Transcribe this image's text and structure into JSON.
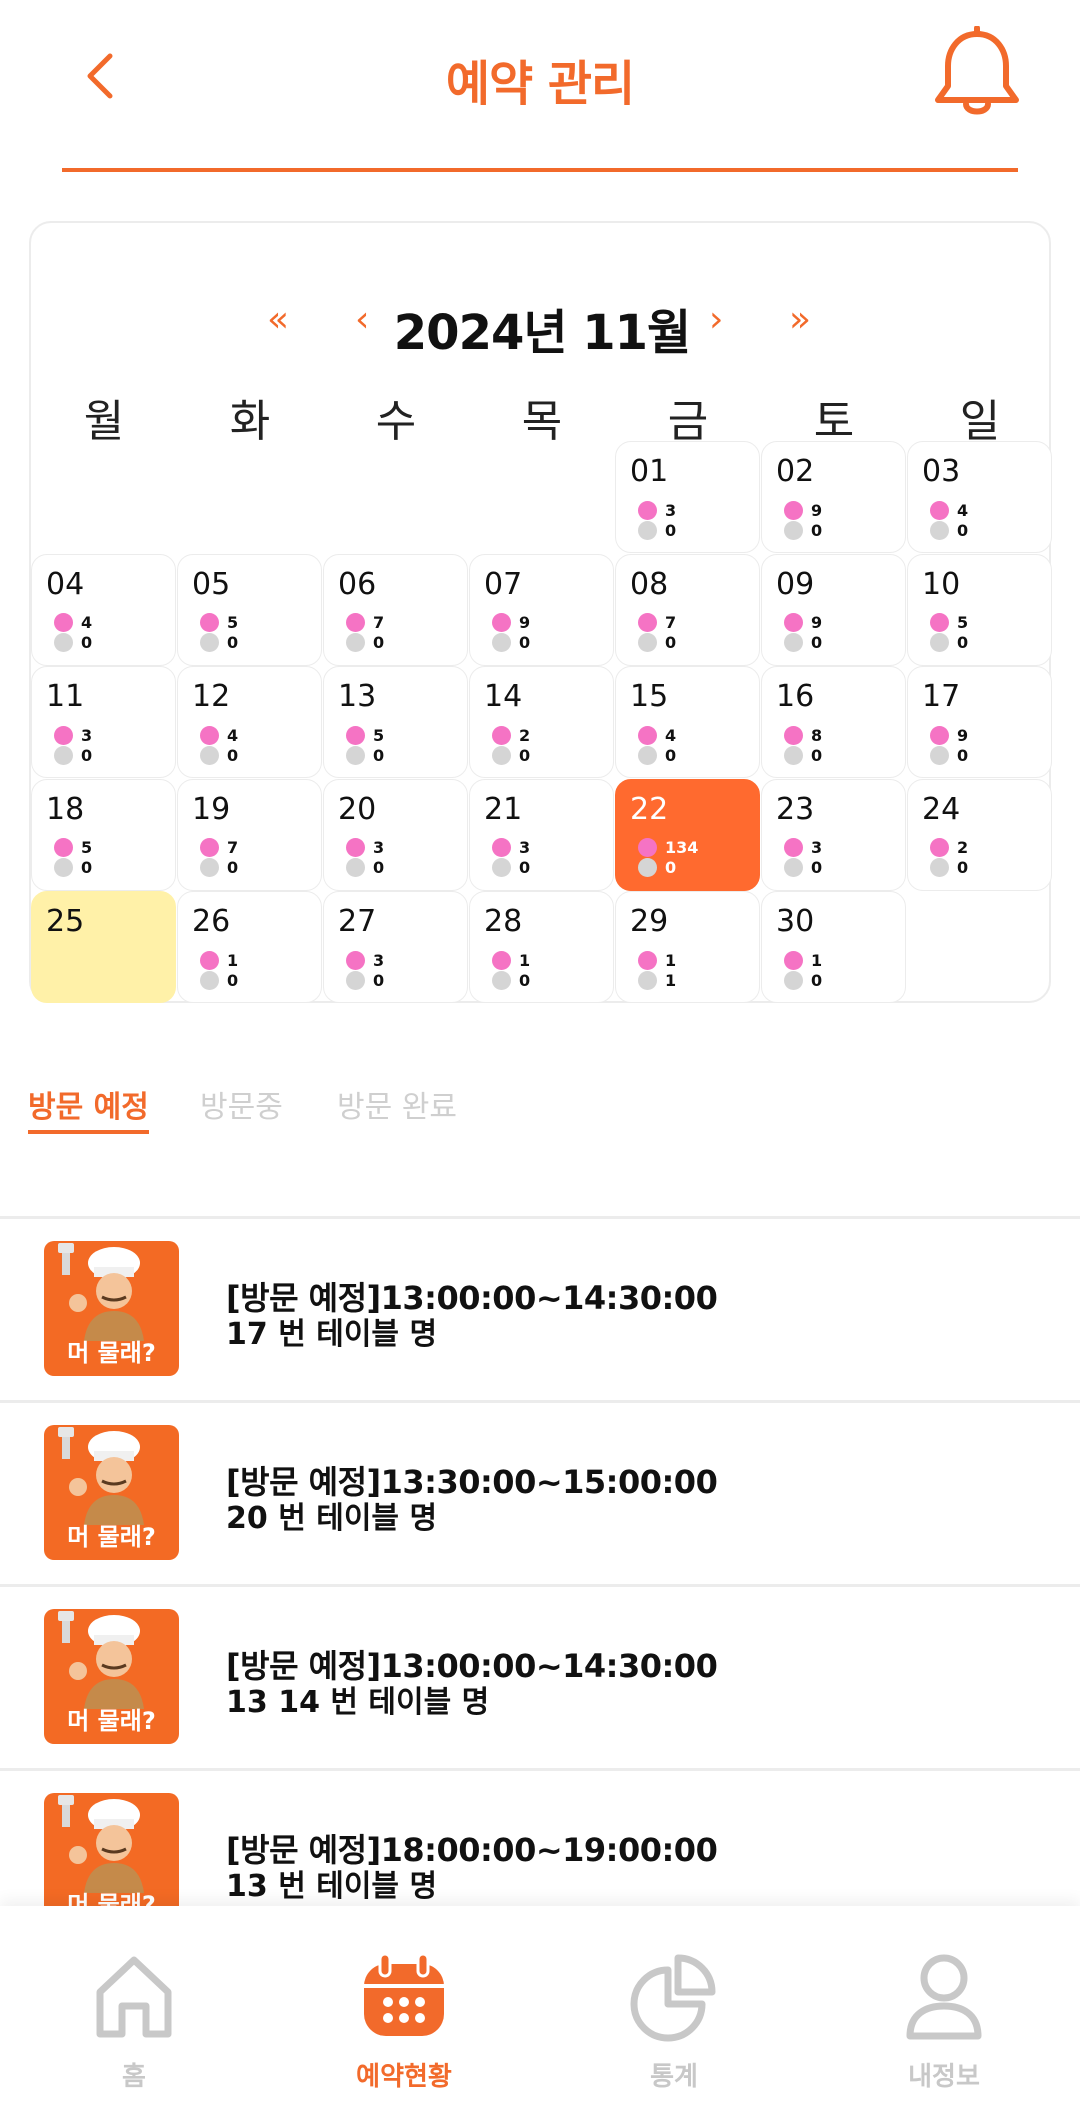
{
  "header": {
    "title": "예약 관리",
    "back_icon": "chevron-left-icon",
    "bell_icon": "bell-icon"
  },
  "colors": {
    "accent": "#f26a2b",
    "selected_day": "#ff6a2f",
    "today": "#fff1a8",
    "pink_dot": "#f573c4",
    "gray_dot": "#d5d5d5"
  },
  "calendar": {
    "title": "2024년 11월",
    "prev_year": "«",
    "prev_month": "‹",
    "next_month": "›",
    "next_year": "»",
    "weekdays": [
      "월",
      "화",
      "수",
      "목",
      "금",
      "토",
      "일"
    ],
    "days": [
      {
        "num": "01",
        "a": "3",
        "b": "0"
      },
      {
        "num": "02",
        "a": "9",
        "b": "0"
      },
      {
        "num": "03",
        "a": "4",
        "b": "0"
      },
      {
        "num": "04",
        "a": "4",
        "b": "0"
      },
      {
        "num": "05",
        "a": "5",
        "b": "0"
      },
      {
        "num": "06",
        "a": "7",
        "b": "0"
      },
      {
        "num": "07",
        "a": "9",
        "b": "0"
      },
      {
        "num": "08",
        "a": "7",
        "b": "0"
      },
      {
        "num": "09",
        "a": "9",
        "b": "0"
      },
      {
        "num": "10",
        "a": "5",
        "b": "0"
      },
      {
        "num": "11",
        "a": "3",
        "b": "0"
      },
      {
        "num": "12",
        "a": "4",
        "b": "0"
      },
      {
        "num": "13",
        "a": "5",
        "b": "0"
      },
      {
        "num": "14",
        "a": "2",
        "b": "0"
      },
      {
        "num": "15",
        "a": "4",
        "b": "0"
      },
      {
        "num": "16",
        "a": "8",
        "b": "0"
      },
      {
        "num": "17",
        "a": "9",
        "b": "0"
      },
      {
        "num": "18",
        "a": "5",
        "b": "0"
      },
      {
        "num": "19",
        "a": "7",
        "b": "0"
      },
      {
        "num": "20",
        "a": "3",
        "b": "0"
      },
      {
        "num": "21",
        "a": "3",
        "b": "0"
      },
      {
        "num": "22",
        "a": "134",
        "b": "0",
        "state": "selected"
      },
      {
        "num": "23",
        "a": "3",
        "b": "0"
      },
      {
        "num": "24",
        "a": "2",
        "b": "0"
      },
      {
        "num": "25",
        "state": "today"
      },
      {
        "num": "26",
        "a": "1",
        "b": "0"
      },
      {
        "num": "27",
        "a": "3",
        "b": "0"
      },
      {
        "num": "28",
        "a": "1",
        "b": "0"
      },
      {
        "num": "29",
        "a": "1",
        "b": "1"
      },
      {
        "num": "30",
        "a": "1",
        "b": "0"
      }
    ]
  },
  "tabs": {
    "scheduled": "방문 예정",
    "visiting": "방문중",
    "completed": "방문 완료"
  },
  "reservations": [
    {
      "line1": "[방문 예정]13:00:00~14:30:00",
      "line2": "17  번 테이블 명",
      "thumb_text": "머 물래?"
    },
    {
      "line1": "[방문 예정]13:30:00~15:00:00",
      "line2": "20  번 테이블 명",
      "thumb_text": "머 물래?"
    },
    {
      "line1": "[방문 예정]13:00:00~14:30:00",
      "line2": "13  14  번 테이블 명",
      "thumb_text": "머 물래?"
    },
    {
      "line1": "[방문 예정]18:00:00~19:00:00",
      "line2": "13  번 테이블 명",
      "thumb_text": "머 물래?"
    }
  ],
  "bottom_nav": {
    "home": "홈",
    "reservations": "예약현황",
    "stats": "통계",
    "my_info": "내정보"
  }
}
